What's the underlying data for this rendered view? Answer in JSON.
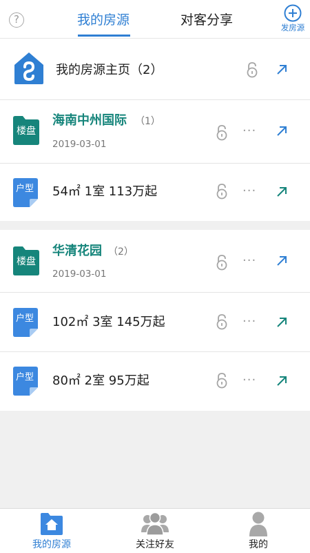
{
  "header": {
    "help_symbol": "?",
    "tabs": [
      {
        "label": "我的房源",
        "active": true
      },
      {
        "label": "对客分享",
        "active": false
      }
    ],
    "post_label": "发房源"
  },
  "homepage_row": {
    "title": "我的房源主页（2）"
  },
  "estates": [
    {
      "tag": "楼盘",
      "name": "海南中州国际",
      "count": "（1）",
      "date": "2019-03-01",
      "units": [
        {
          "tag": "户型",
          "text": "54㎡ 1室 113万起"
        }
      ]
    },
    {
      "tag": "楼盘",
      "name": "华清花园",
      "count": "（2）",
      "date": "2019-03-01",
      "units": [
        {
          "tag": "户型",
          "text": "102㎡ 3室 145万起"
        },
        {
          "tag": "户型",
          "text": "80㎡ 2室 95万起"
        }
      ]
    }
  ],
  "more_symbol": "···",
  "tabbar": [
    {
      "label": "我的房源",
      "icon": "house-icon",
      "active": true
    },
    {
      "label": "关注好友",
      "icon": "friends-icon",
      "active": false
    },
    {
      "label": "我的",
      "icon": "person-icon",
      "active": false
    }
  ],
  "colors": {
    "accent": "#2f7fd3",
    "estate_green": "#16857b",
    "unit_blue": "#3c88e0",
    "inactive_gray": "#a0a0a0"
  }
}
